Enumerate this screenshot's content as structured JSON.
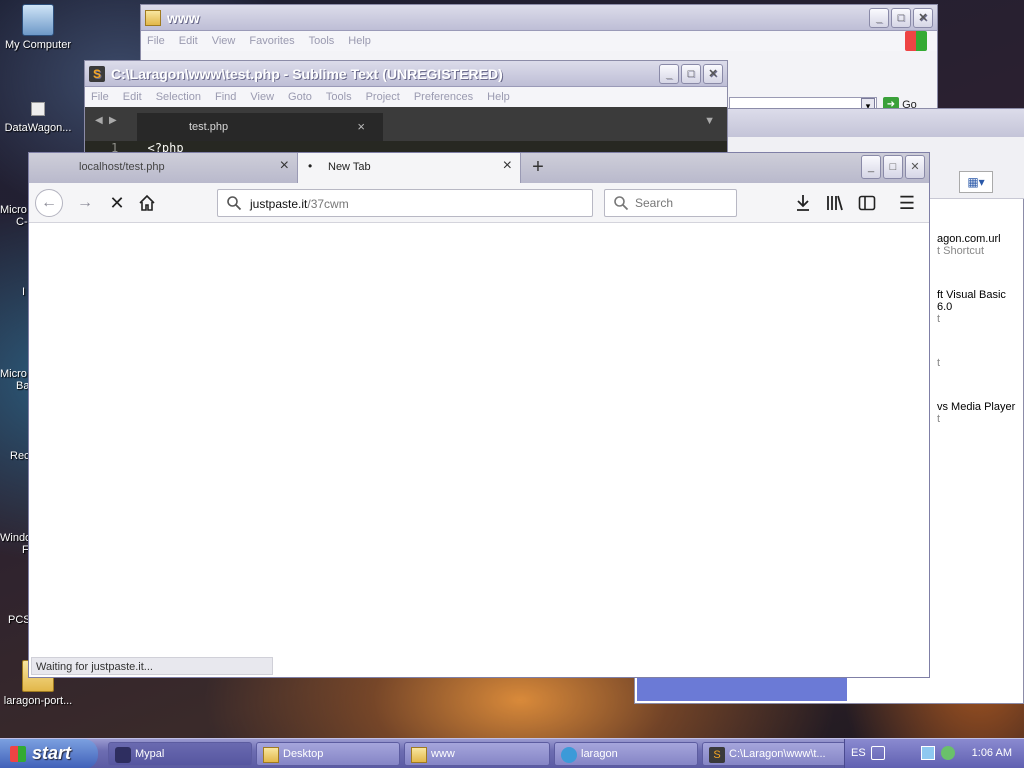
{
  "desktop": {
    "icons": [
      {
        "label": "My Computer"
      },
      {
        "label": "DataWagon..."
      },
      {
        "label": "laragon-port..."
      }
    ],
    "partial_labels": [
      "Micro",
      "C-",
      "I",
      "Micro",
      "Ba",
      "Rec",
      "Windo",
      "F",
      "PCS"
    ]
  },
  "explorer": {
    "title": "www",
    "menu": [
      "File",
      "Edit",
      "View",
      "Favorites",
      "Tools",
      "Help"
    ],
    "go_label": "Go",
    "items": [
      {
        "name": "agon.com.url",
        "type": "t Shortcut"
      },
      {
        "name": "ft Visual Basic 6.0",
        "type": "t"
      },
      {
        "name": "",
        "type": "t"
      },
      {
        "name": "vs Media Player",
        "type": "t"
      }
    ]
  },
  "sublime": {
    "title": "C:\\Laragon\\www\\test.php - Sublime Text (UNREGISTERED)",
    "menu": [
      "File",
      "Edit",
      "Selection",
      "Find",
      "View",
      "Goto",
      "Tools",
      "Project",
      "Preferences",
      "Help"
    ],
    "tab_label": "test.php",
    "line_number": "1",
    "code_line": "<?php"
  },
  "firefox": {
    "tabs": [
      {
        "label": "localhost/test.php",
        "active": false
      },
      {
        "label": "New Tab",
        "active": true
      }
    ],
    "url_host": "justpaste.it",
    "url_path": "/37cwm",
    "search_placeholder": "Search",
    "status_text": "Waiting for justpaste.it..."
  },
  "taskbar": {
    "start_label": "start",
    "tasks": [
      {
        "label": "Mypal",
        "active": true
      },
      {
        "label": "Desktop",
        "active": false
      },
      {
        "label": "www",
        "active": false
      },
      {
        "label": "laragon",
        "active": false
      },
      {
        "label": "C:\\Laragon\\www\\t...",
        "active": false
      }
    ],
    "language": "ES",
    "clock": "1:06 AM"
  }
}
